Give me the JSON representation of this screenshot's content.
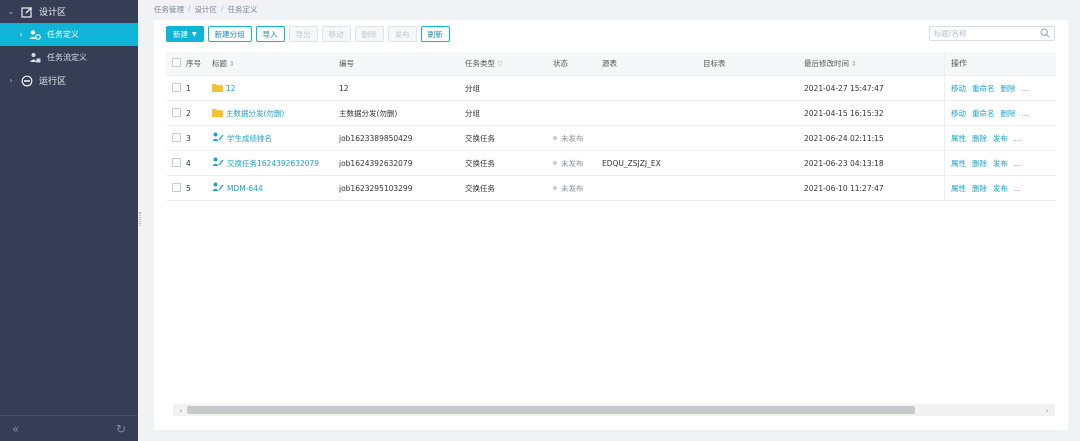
{
  "sidebar": {
    "groups": [
      {
        "label": "设计区",
        "expanded": true,
        "icon": "edit-icon"
      },
      {
        "label": "运行区",
        "expanded": false,
        "icon": "run-icon"
      }
    ],
    "items": [
      {
        "label": "任务定义",
        "active": true,
        "icon": "task-def-icon"
      },
      {
        "label": "任务流定义",
        "active": false,
        "icon": "task-flow-icon"
      }
    ],
    "collapse_icon": "double-chevron-left-icon",
    "refresh_icon": "refresh-icon"
  },
  "breadcrumb": [
    "任务管理",
    "设计区",
    "任务定义"
  ],
  "toolbar": {
    "new_label": "新建",
    "new_group_label": "新建分组",
    "import_label": "导入",
    "export_label": "导出",
    "move_label": "移动",
    "delete_label": "删除",
    "publish_label": "发布",
    "refresh_label": "刷新"
  },
  "search": {
    "placeholder": "标题/名称",
    "value": ""
  },
  "table": {
    "headers": {
      "index": "序号",
      "title": "标题",
      "code": "编号",
      "type": "任务类型",
      "status": "状态",
      "source": "源表",
      "target": "目标表",
      "modified": "最后修改时间",
      "ops": "操作"
    },
    "rows": [
      {
        "index": "1",
        "title": "12",
        "kind": "folder",
        "code": "12",
        "type": "分组",
        "status": "",
        "source": "",
        "target": "",
        "modified": "2021-04-27 15:47:47",
        "ops": [
          "移动",
          "重命名",
          "删除",
          "..."
        ]
      },
      {
        "index": "2",
        "title": "主数据分发(勿删)",
        "kind": "folder",
        "code": "主数据分发(勿删)",
        "type": "分组",
        "status": "",
        "source": "",
        "target": "",
        "modified": "2021-04-15 16:15:32",
        "ops": [
          "移动",
          "重命名",
          "删除",
          "..."
        ]
      },
      {
        "index": "3",
        "title": "学生成绩排名",
        "kind": "task",
        "code": "job1623389850429",
        "type": "交换任务",
        "status": "未发布",
        "source": "",
        "target": "",
        "modified": "2021-06-24 02:11:15",
        "ops": [
          "属性",
          "删除",
          "发布",
          "..."
        ]
      },
      {
        "index": "4",
        "title": "交换任务1624392632079",
        "kind": "task",
        "code": "job1624392632079",
        "type": "交换任务",
        "status": "未发布",
        "source": "EDQU_ZSJZJ_EX",
        "target": "",
        "modified": "2021-06-23 04:13:18",
        "ops": [
          "属性",
          "删除",
          "发布",
          "..."
        ]
      },
      {
        "index": "5",
        "title": "MDM-644",
        "kind": "task",
        "code": "job1623295103299",
        "type": "交换任务",
        "status": "未发布",
        "source": "",
        "target": "",
        "modified": "2021-06-10 11:27:47",
        "ops": [
          "属性",
          "删除",
          "发布",
          "..."
        ]
      }
    ]
  },
  "colors": {
    "accent": "#0fb4d8",
    "sidebar_bg": "#353e54",
    "folder": "#f2c230",
    "link": "#1aa3cc"
  }
}
